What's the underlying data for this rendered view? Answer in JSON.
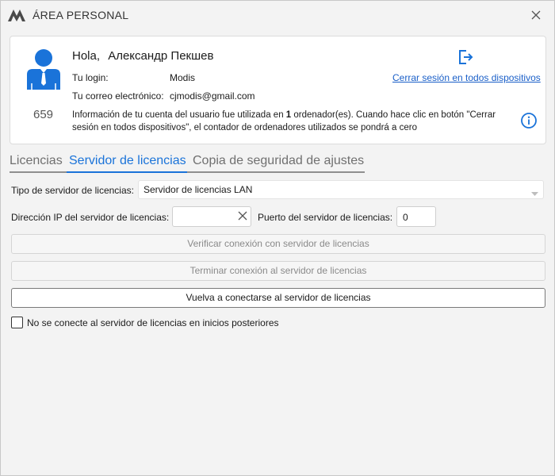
{
  "window": {
    "title": "ÁREA PERSONAL"
  },
  "user": {
    "greeting": "Hola,",
    "name": "Александр Пекшев",
    "login_label": "Tu login:",
    "login_value": "Modis",
    "email_label": "Tu correo electrónico:",
    "email_value": "cjmodis@gmail.com",
    "device_code": "659",
    "logout_link": "Cerrar sesión en todos dispositivos",
    "info_text_1": "Información de tu cuenta del usuario fue utilizada en ",
    "info_count": "1",
    "info_text_2": " ordenador(es). Cuando hace clic en botón \"Cerrar sesión en todos dispositivos\", el contador de ordenadores utilizados se pondrá a cero"
  },
  "tabs": [
    {
      "label": "Licencias"
    },
    {
      "label": "Servidor de licencias"
    },
    {
      "label": "Copia de seguridad de ajustes"
    }
  ],
  "form": {
    "server_type_label": "Tipo de servidor de licencias:",
    "server_type_value": "Servidor de licencias LAN",
    "ip_label": "Dirección IP del servidor de licencias:",
    "ip_value": "",
    "port_label": "Puerto del servidor de licencias:",
    "port_value": "0",
    "verify_button": "Verificar conexión con servidor de licencias",
    "terminate_button": "Terminar conexión al servidor de licencias",
    "reconnect_button": "Vuelva a conectarse al servidor de licencias",
    "no_connect_label": "No se conecte al servidor de licencias en inicios posteriores"
  },
  "colors": {
    "accent": "#1a73d9",
    "link": "#1a5fc8",
    "avatar": "#1a73d9"
  }
}
